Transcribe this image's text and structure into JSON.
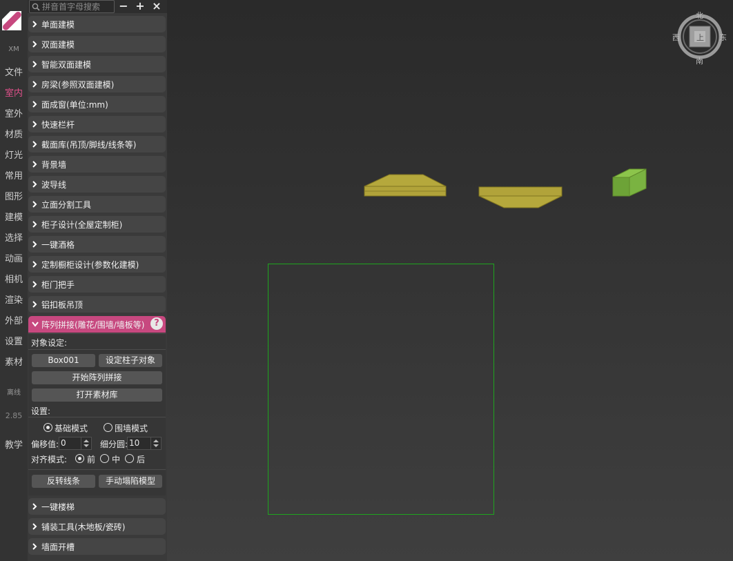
{
  "nav": {
    "items": [
      {
        "id": "xm",
        "label": "XM"
      },
      {
        "id": "file",
        "label": "文件"
      },
      {
        "id": "indoor",
        "label": "室内"
      },
      {
        "id": "outdoor",
        "label": "室外"
      },
      {
        "id": "material",
        "label": "材质"
      },
      {
        "id": "light",
        "label": "灯光"
      },
      {
        "id": "common",
        "label": "常用"
      },
      {
        "id": "shape",
        "label": "图形"
      },
      {
        "id": "model",
        "label": "建模"
      },
      {
        "id": "select",
        "label": "选择"
      },
      {
        "id": "anim",
        "label": "动画"
      },
      {
        "id": "camera",
        "label": "相机"
      },
      {
        "id": "render",
        "label": "渲染"
      },
      {
        "id": "external",
        "label": "外部"
      },
      {
        "id": "settings",
        "label": "设置"
      },
      {
        "id": "assets",
        "label": "素材"
      },
      {
        "id": "offline",
        "label": "离线"
      },
      {
        "id": "version",
        "label": "2.85"
      },
      {
        "id": "tutorial",
        "label": "教学"
      }
    ],
    "active": "室内"
  },
  "search": {
    "placeholder": "拼音首字母搜索"
  },
  "toolbar": {
    "minus": "−",
    "plus": "+",
    "close": "×"
  },
  "sections_top": [
    "单面建模",
    "双面建模",
    "智能双面建模",
    "房梁(参照双面建模)",
    "面成窗(单位:mm)",
    "快速栏杆",
    "截面库(吊顶/脚线/线条等)",
    "背景墙",
    "波导线",
    "立面分割工具",
    "柜子设计(全屋定制柜)",
    "一键酒格",
    "定制橱柜设计(参数化建模)",
    "柜门把手",
    "铝扣板吊顶"
  ],
  "open_section": {
    "title": "阵列拼接(雕花/围墙/墙板等)",
    "help": "?",
    "object_label": "对象设定:",
    "object_name": "Box001",
    "set_pillar": "设定柱子对象",
    "start": "开始阵列拼接",
    "open_lib": "打开素材库",
    "settings_label": "设置:",
    "mode_basic": "基础模式",
    "mode_wall": "围墙模式",
    "offset_label": "偏移值:",
    "offset_value": "0",
    "subdiv_label": "细分圆:",
    "subdiv_value": "10",
    "align_label": "对齐模式:",
    "align_front": "前",
    "align_mid": "中",
    "align_back": "后",
    "reverse": "反转线条",
    "collapse": "手动塌陷模型"
  },
  "sections_bottom": [
    "一键楼梯",
    "铺装工具(木地板/瓷砖)",
    "墙面开槽"
  ],
  "compass": {
    "north": "北",
    "south": "南",
    "east": "东",
    "west": "西",
    "center": "上"
  },
  "colors": {
    "accent": "#c7487f",
    "selection": "#1ea51e",
    "olive": "#b1a33a",
    "green": "#7ab341"
  }
}
